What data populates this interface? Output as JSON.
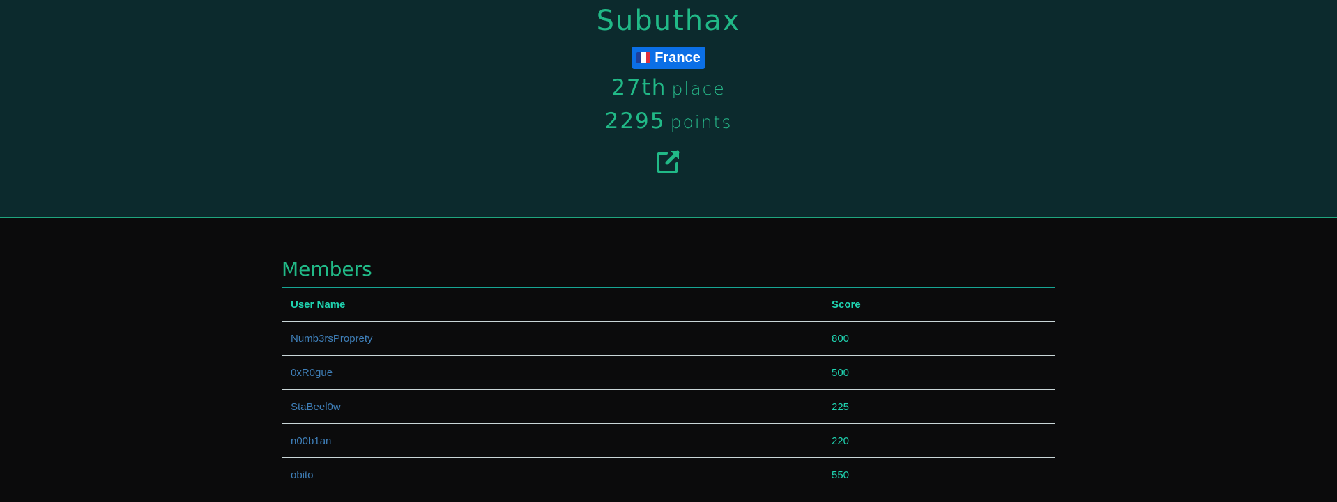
{
  "team": {
    "name": "Subuthax",
    "country": "France",
    "place_number": "27th",
    "place_label": "place",
    "points_number": "2295",
    "points_label": "points"
  },
  "icons": {
    "flag": "france-flag-icon",
    "external": "external-link-icon"
  },
  "colors": {
    "header_bg": "#0c2a2d",
    "accent": "#21b987",
    "badge": "#0b6fe6",
    "page_bg": "#0b0b0c",
    "link": "#3f7fb8"
  },
  "members": {
    "title": "Members",
    "columns": [
      "User Name",
      "Score"
    ],
    "rows": [
      {
        "name": "Numb3rsProprety",
        "score": "800"
      },
      {
        "name": "0xR0gue",
        "score": "500"
      },
      {
        "name": "StaBeel0w",
        "score": "225"
      },
      {
        "name": "n00b1an",
        "score": "220"
      },
      {
        "name": "obito",
        "score": "550"
      }
    ]
  }
}
